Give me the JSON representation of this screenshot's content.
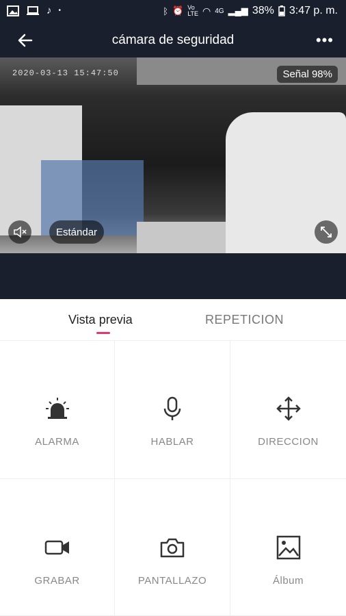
{
  "status_bar": {
    "time": "3:47 p. m.",
    "battery": "38%",
    "network": "4G"
  },
  "header": {
    "title": "cámara de seguridad"
  },
  "video": {
    "timestamp": "2020-03-13  15:47:50",
    "signal": "Señal  98%",
    "quality": "Estándar"
  },
  "tabs": {
    "preview": "Vista previa",
    "playback": "REPETICION"
  },
  "actions": {
    "alarm": "ALARMA",
    "talk": "HABLAR",
    "direction": "DIRECCION",
    "record": "GRABAR",
    "screenshot": "PANTALLAZO",
    "album": "Álbum"
  },
  "colors": {
    "accent": "#e8356f",
    "header_bg": "#1a1f2e"
  }
}
